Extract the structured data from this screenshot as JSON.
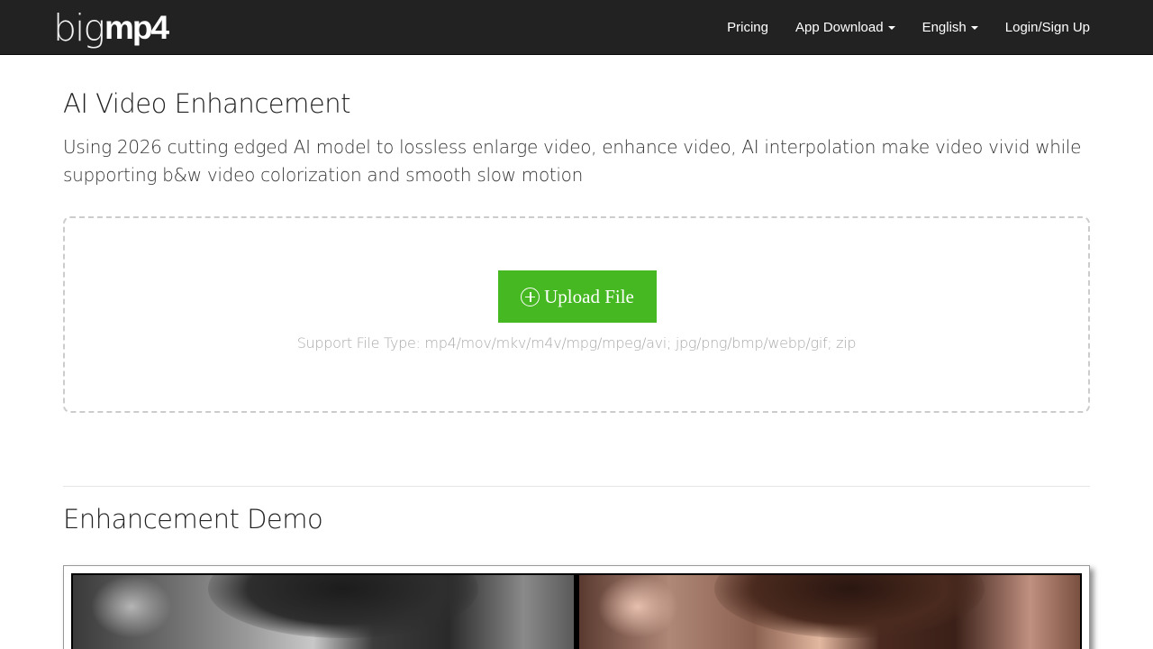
{
  "navbar": {
    "logo_light": "big",
    "logo_bold": "mp4",
    "links": [
      {
        "label": "Pricing",
        "dropdown": false
      },
      {
        "label": "App Download",
        "dropdown": true
      },
      {
        "label": "English",
        "dropdown": true
      },
      {
        "label": "Login/Sign Up",
        "dropdown": false
      }
    ]
  },
  "main": {
    "title": "AI Video Enhancement",
    "subtitle": "Using 2026 cutting edged AI model to lossless enlarge video, enhance video, AI interpolation make video vivid while supporting b&w video colorization and smooth slow motion"
  },
  "upload": {
    "button_label": "Upload File",
    "button_icon": "plus-circle-icon",
    "support_text": "Support File Type: mp4/mov/mkv/m4v/mpg/mpeg/avi; jpg/png/bmp/webp/gif; zip"
  },
  "demo": {
    "title": "Enhancement Demo"
  },
  "colors": {
    "navbar_bg": "#222222",
    "upload_button": "#46b822",
    "support_text": "#aaaaaa"
  }
}
